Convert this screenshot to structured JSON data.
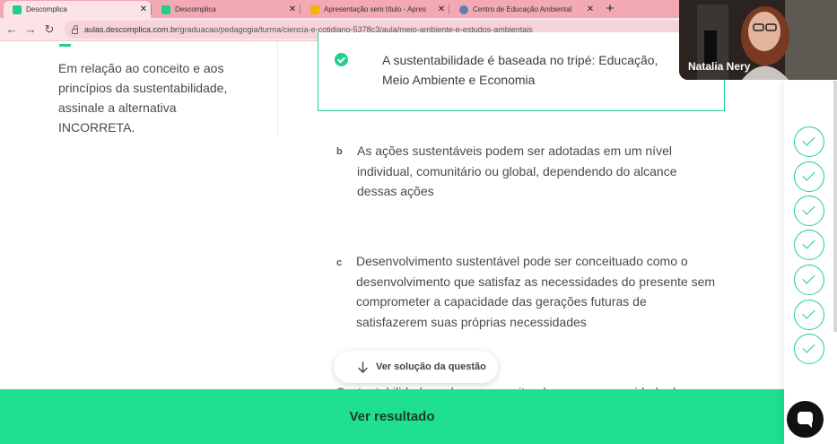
{
  "browser": {
    "tabs": [
      {
        "title": "Descomplica",
        "active": true,
        "icon": "descomplica-favicon"
      },
      {
        "title": "Descomplica",
        "active": false,
        "icon": "descomplica-favicon"
      },
      {
        "title": "Apresentação sem título - Apres",
        "active": false,
        "icon": "slides-favicon"
      },
      {
        "title": "Centro de Educação Ambiental",
        "active": false,
        "icon": "globe-favicon"
      }
    ],
    "close_glyph": "✕",
    "new_tab_glyph": "+",
    "url_host": "aulas.descomplica.com.br",
    "url_path": "/graduacao/pedagogia/turma/ciencia-e-cotidiano-5378c3/aula/meio-ambiente-e-estudos-ambientais",
    "back_glyph": "←",
    "forward_glyph": "→",
    "reload_glyph": "↻"
  },
  "question": {
    "prompt": "Em relação ao conceito e aos princípios da sustentabilidade, assinale a alternativa INCORRETA."
  },
  "alternatives": {
    "a": {
      "text": "A sustentabilidade é baseada no tripé: Educação, Meio Ambiente e Economia",
      "selected": true
    },
    "b": {
      "letter": "b",
      "text": "As ações sustentáveis podem ser adotadas em um nível individual, comunitário ou global, dependendo do alcance dessas ações"
    },
    "c": {
      "letter": "c",
      "text": "Desenvolvimento sustentável pode ser conceituado como o desenvolvimento que satisfaz as necessidades do presente sem comprometer a capacidade das gerações futuras de satisfazerem suas próprias necessidades"
    },
    "d": {
      "letter": "d",
      "text": "Sustentabilidade pode ser conceituada como a capacidade de"
    }
  },
  "solution_button": {
    "label": "Ver solução da questão"
  },
  "result_button": {
    "label": "Ver resultado"
  },
  "progress": {
    "completed": 7
  },
  "webcam": {
    "participant_name": "Natalia Nery"
  },
  "colors": {
    "accent": "#1fcf8a",
    "result_bar": "#1fe08f",
    "tabstrip": "#f2a9b3"
  }
}
